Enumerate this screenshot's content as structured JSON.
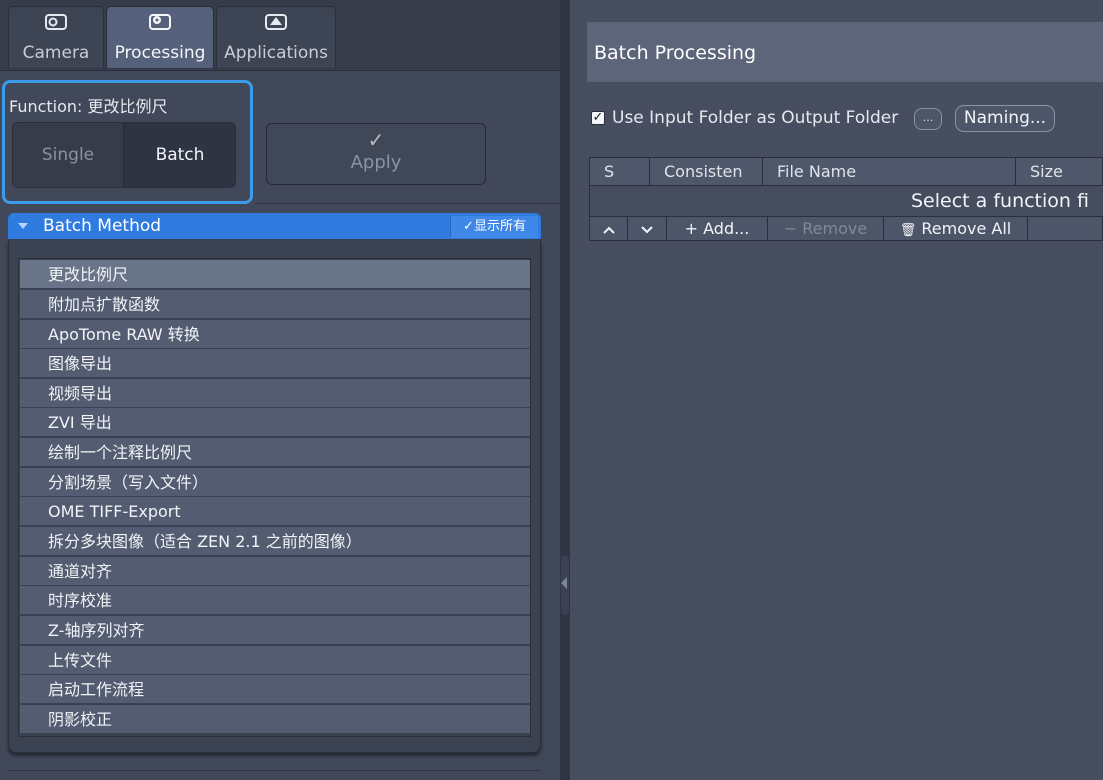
{
  "tabs": [
    {
      "label": "Camera",
      "icon": "camera-icon"
    },
    {
      "label": "Processing",
      "icon": "gear-icon"
    },
    {
      "label": "Applications",
      "icon": "applications-icon"
    }
  ],
  "function": {
    "label": "Function:",
    "value": "更改比例尺",
    "modes": [
      "Single",
      "Batch"
    ],
    "selected_mode": "Batch"
  },
  "apply": {
    "label": "Apply",
    "icon": "checkmark-icon"
  },
  "batch_method": {
    "title": "Batch Method",
    "show_all": "✓显示所有",
    "items": [
      "更改比例尺",
      "附加点扩散函数",
      "ApoTome RAW 转换",
      "图像导出",
      "视频导出",
      "ZVI 导出",
      "绘制一个注释比例尺",
      "分割场景（写入文件）",
      "OME TIFF-Export",
      "拆分多块图像（适合 ZEN 2.1 之前的图像）",
      "通道对齐",
      "时序校准",
      "Z-轴序列对齐",
      "上传文件",
      "启动工作流程",
      "阴影校正"
    ],
    "selected_index": 0
  },
  "batch_processing": {
    "title": "Batch Processing",
    "use_input_folder": {
      "label": "Use Input Folder as Output Folder",
      "checked": true
    },
    "ellipsis_button": "...",
    "naming_button": "Naming...",
    "columns": [
      "S",
      "Consisten",
      "File Name",
      "Size"
    ],
    "empty_message": "Select a function fi",
    "toolbar": {
      "up": "⌃",
      "down": "⌄",
      "add": "+ Add...",
      "remove": "− Remove",
      "remove_all": "Remove All"
    }
  },
  "colors": {
    "accent": "#3d9be9",
    "header_blue": "#2f7be0",
    "panel_bg": "#404859",
    "list_item": "#535c70",
    "list_selected": "#6a7489"
  }
}
